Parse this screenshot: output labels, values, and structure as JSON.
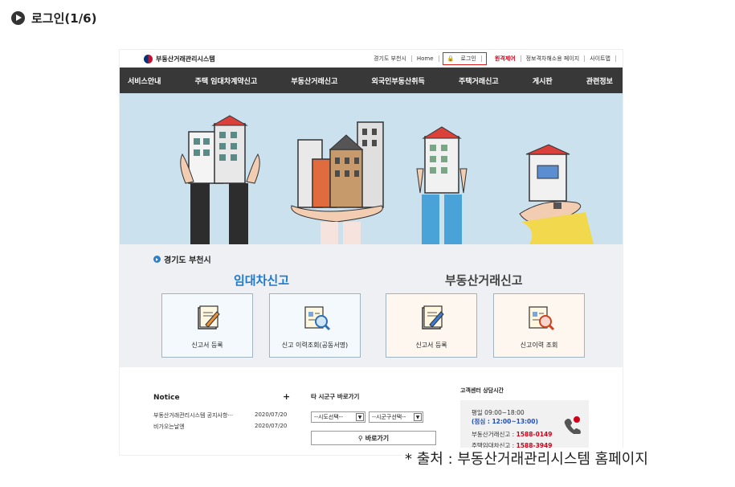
{
  "slide": {
    "title": "로그인(1/6)"
  },
  "site": {
    "logo_text": "부동산거래관리시스템",
    "toplinks": [
      "경기도 부천시",
      "Home",
      "로그인",
      "원격제어",
      "정보격차해소용 페이지",
      "사이트맵"
    ],
    "nav": [
      "서비스안내",
      "주택 임대차계약신고",
      "부동산거래신고",
      "외국인부동산취득",
      "주택거래신고",
      "게시판",
      "관련정보"
    ]
  },
  "main": {
    "region": "경기도 부천시",
    "category_rent": "임대차신고",
    "category_estate": "부동산거래신고",
    "cards": [
      {
        "label": "신고서 등록",
        "icon": "pencil-document-icon",
        "tone": "blue"
      },
      {
        "label": "신고 이력조회(공동서명)",
        "icon": "magnifier-document-icon",
        "tone": "blue"
      },
      {
        "label": "신고서 등록",
        "icon": "pencil-document-icon",
        "tone": "orange"
      },
      {
        "label": "신고이력 조회",
        "icon": "magnifier-document-icon",
        "tone": "orange"
      }
    ]
  },
  "notice": {
    "title": "Notice",
    "plus": "+",
    "rows": [
      {
        "text": "부동산거래관리시스템 공지사항···",
        "date": "2020/07/20"
      },
      {
        "text": "비가오는날엔",
        "date": "2020/07/20"
      }
    ]
  },
  "goto": {
    "title": "타 시군구 바로가기",
    "select_province": "--시도선택--",
    "select_city": "--시군구선택--",
    "button": "바로가기"
  },
  "customer": {
    "title": "고객센터 상담시간",
    "weekday": "평일 09:00~18:00",
    "lunch": "(점심 : 12:00~13:00)",
    "estate_label": "부동산거래신고 : ",
    "estate_num": "1588-0149",
    "rent_label": "주택임대차신고 : ",
    "rent_num": "1588-3949"
  },
  "source_caption": "* 출처 : 부동산거래관리시스템 홈페이지",
  "colors": {
    "nav_bg": "#383838",
    "hero_bg": "#cbe2ee",
    "accent_blue": "#1f78c8",
    "accent_red": "#d0021b"
  }
}
